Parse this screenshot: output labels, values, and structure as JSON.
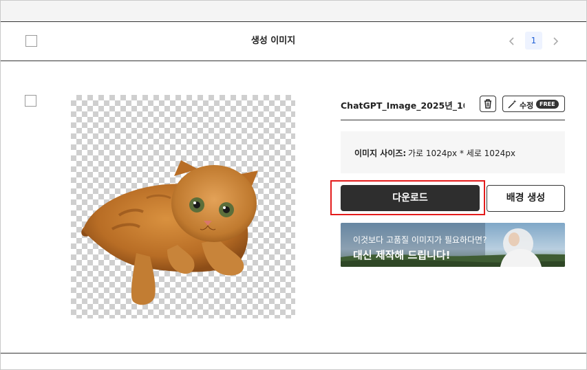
{
  "header": {
    "title": "생성 이미지",
    "pager": {
      "prev_icon": "chevron-left-icon",
      "current": "1",
      "next_icon": "chevron-right-icon"
    }
  },
  "item": {
    "filename": "ChatGPT_Image_2025년_10...",
    "edit_label": "수정",
    "edit_badge": "FREE",
    "size_label": "이미지 사이즈:",
    "size_value": "가로 1024px * 세로 1024px",
    "download_label": "다운로드",
    "background_label": "배경 생성"
  },
  "banner": {
    "line1": "이것보다 고품질 이미지가 필요하다면?",
    "line2": "대신 제작해 드립니다!"
  },
  "colors": {
    "download_bg": "#2e2e2e",
    "highlight": "#e31b1b",
    "pager_active_bg": "#eef3ff",
    "pager_active_text": "#1f5fd6"
  }
}
